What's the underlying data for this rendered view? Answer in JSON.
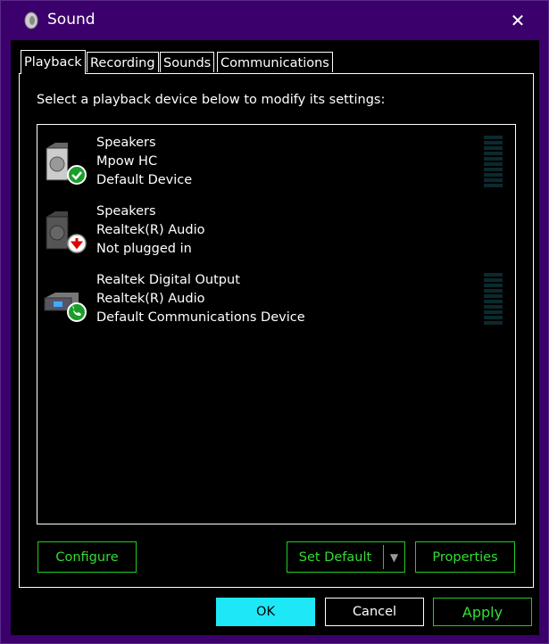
{
  "window": {
    "title": "Sound",
    "close_label": "✕"
  },
  "tabs": [
    {
      "label": "Playback",
      "active": true
    },
    {
      "label": "Recording"
    },
    {
      "label": "Sounds"
    },
    {
      "label": "Communications"
    }
  ],
  "instruction": "Select a playback device below to modify its settings:",
  "devices": [
    {
      "name": "Speakers",
      "driver": "Mpow HC",
      "status": "Default Device",
      "icon": "speaker-icon",
      "badge": "check-icon",
      "level": 0
    },
    {
      "name": "Speakers",
      "driver": "Realtek(R) Audio",
      "status": "Not plugged in",
      "icon": "speaker-icon",
      "badge": "unplugged-arrow-icon"
    },
    {
      "name": "Realtek Digital Output",
      "driver": "Realtek(R) Audio",
      "status": "Default Communications Device",
      "icon": "digital-output-icon",
      "badge": "phone-icon",
      "level": 0
    }
  ],
  "buttons": {
    "configure": "Configure",
    "set_default": "Set Default",
    "properties": "Properties",
    "ok": "OK",
    "cancel": "Cancel",
    "apply": "Apply"
  },
  "colors": {
    "titlebar": "#3b006b",
    "accent_green": "#33dd33",
    "ok_bg": "#1ee8f8"
  }
}
